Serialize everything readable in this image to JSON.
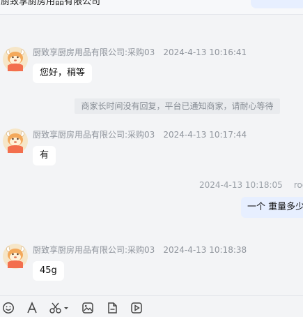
{
  "header": {
    "title": "厨致享厨房用品有限公司"
  },
  "messages": [
    {
      "sender": "厨致享厨房用品有限公司:采购03",
      "time": "2024-4-13 10:16:41",
      "text": "您好，稍等"
    },
    {
      "sender": "厨致享厨房用品有限公司:采购03",
      "time": "2024-4-13 10:17:44",
      "text": "有"
    },
    {
      "sender": "厨致享厨房用品有限公司:采购03",
      "time": "2024-4-13 10:18:38",
      "text": "45g"
    }
  ],
  "system_notice": "商家长时间没有回复，平台已通知商家，请耐心等待",
  "right_message": {
    "time": "2024-4-13 10:18:05",
    "sender": "rool",
    "text": "一个 重量多少"
  },
  "toolbar": {
    "icons": [
      "emoji-icon",
      "font-icon",
      "screenshot-icon",
      "image-icon",
      "file-icon",
      "video-icon"
    ]
  },
  "colors": {
    "page_background": "#f3f4f6",
    "left_bubble": "#ffffff",
    "right_bubble": "#e7efff",
    "muted_text": "#8f949c",
    "notice_background": "#e9ebee"
  }
}
